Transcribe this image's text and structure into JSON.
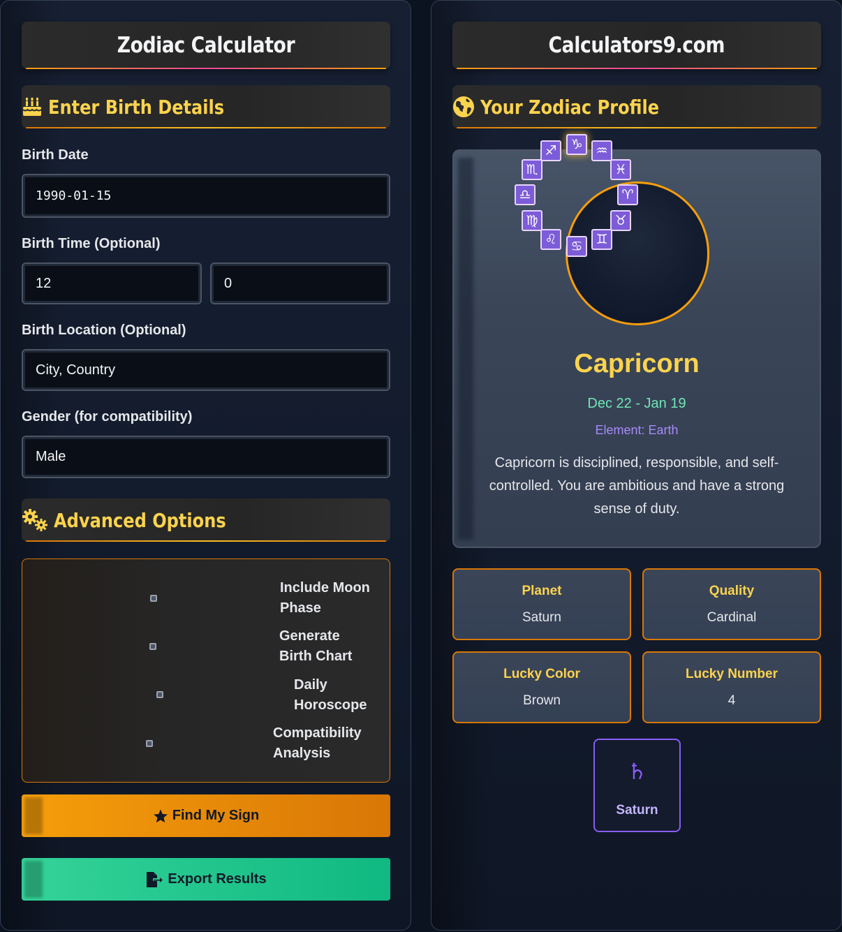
{
  "left": {
    "title": "Zodiac Calculator",
    "birth_section": {
      "title": "Enter Birth Details",
      "icon": "birthday-cake-icon"
    },
    "birth_date": {
      "label": "Birth Date",
      "value": "1990-01-15"
    },
    "birth_time": {
      "label": "Birth Time (Optional)",
      "hour": "12",
      "minute": "0"
    },
    "birth_location": {
      "label": "Birth Location (Optional)",
      "placeholder": "City, Country"
    },
    "gender": {
      "label": "Gender (for compatibility)",
      "value": "Male"
    },
    "advanced_section": {
      "title": "Advanced Options",
      "icon": "gears-icon"
    },
    "options": [
      {
        "line1": "Include Moon",
        "line2": "Phase"
      },
      {
        "line1": "Generate",
        "line2": "Birth Chart"
      },
      {
        "line1": "Daily",
        "line2": "Horoscope"
      },
      {
        "line1": "Compatibility",
        "line2": "Analysis"
      }
    ],
    "find_button": {
      "label": "Find My Sign",
      "icon": "star-icon"
    },
    "export_button": {
      "label": "Export Results",
      "icon": "file-export-icon"
    }
  },
  "right": {
    "title": "Calculators9.com",
    "profile_section": {
      "title": "Your Zodiac Profile",
      "icon": "globe-icon"
    },
    "zodiac_wheel": [
      "♑",
      "♒",
      "♓",
      "♈",
      "♉",
      "♊",
      "♋",
      "♌",
      "♍",
      "♎",
      "♏",
      "♐"
    ],
    "sign": {
      "name": "Capricorn",
      "dates": "Dec 22 - Jan 19",
      "element": "Element: Earth",
      "description": "Capricorn is disciplined, responsible, and self-controlled. You are ambitious and have a strong sense of duty."
    },
    "info": {
      "planet": {
        "title": "Planet",
        "value": "Saturn"
      },
      "quality": {
        "title": "Quality",
        "value": "Cardinal"
      },
      "lucky_color": {
        "title": "Lucky Color",
        "value": "Brown"
      },
      "lucky_number": {
        "title": "Lucky Number",
        "value": "4"
      }
    },
    "ruling_planet": {
      "symbol": "♄",
      "name": "Saturn"
    }
  },
  "colors": {
    "accent": "#fcd34d",
    "orange": "#f59e0b",
    "green": "#10b981",
    "purple": "#8b5cf6",
    "pink": "#ec4899"
  }
}
